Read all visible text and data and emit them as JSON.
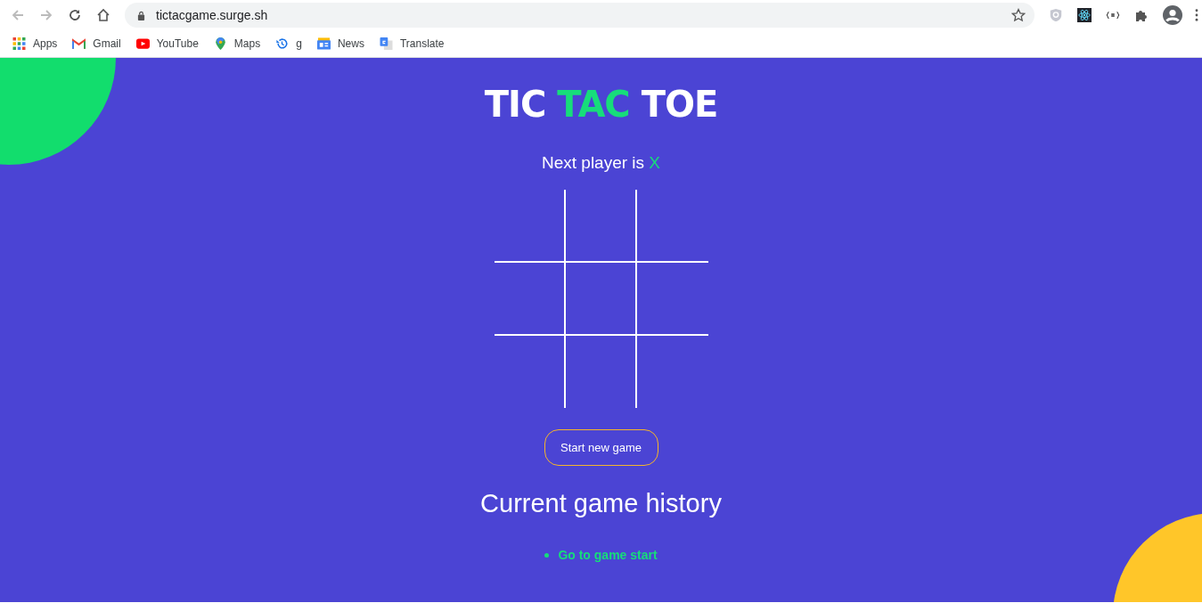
{
  "browser": {
    "url": "tictacgame.surge.sh",
    "bookmarks": [
      {
        "label": "Apps",
        "kind": "apps"
      },
      {
        "label": "Gmail",
        "kind": "gmail"
      },
      {
        "label": "YouTube",
        "kind": "youtube"
      },
      {
        "label": "Maps",
        "kind": "maps"
      },
      {
        "label": "g",
        "kind": "history"
      },
      {
        "label": "News",
        "kind": "news"
      },
      {
        "label": "Translate",
        "kind": "translate"
      }
    ]
  },
  "title_parts": [
    {
      "text": "TIC",
      "highlight": false
    },
    {
      "text": "TAC",
      "highlight": true
    },
    {
      "text": "TOE",
      "highlight": false
    }
  ],
  "status": {
    "text": "Next player is",
    "player": "X"
  },
  "new_game_button": "Start new game",
  "history": {
    "heading": "Current game history",
    "moves": [
      "Go to game start"
    ]
  }
}
